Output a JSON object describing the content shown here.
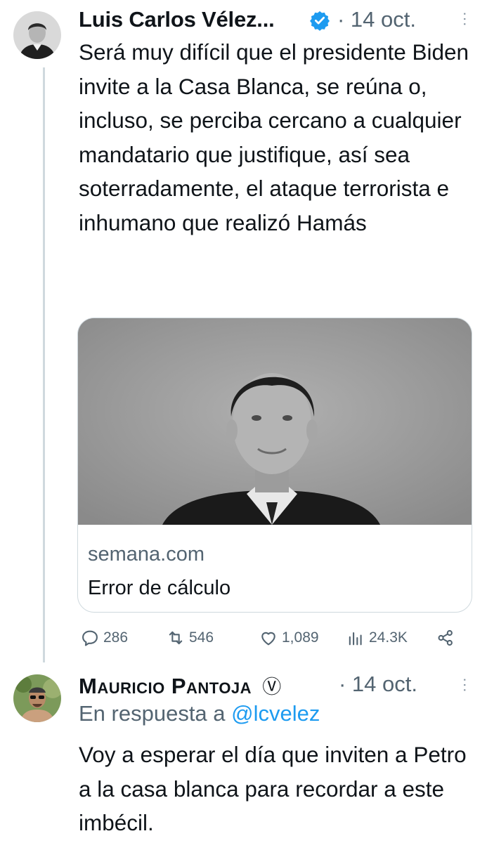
{
  "tweet": {
    "author_name": "Luis Carlos Vélez...",
    "verified_icon": "verified-badge-icon",
    "time": "· 14 oct.",
    "more": "···",
    "text": "Será muy difícil que el presidente Biden invite a la Casa Blanca, se reúna o, incluso, se perciba cercano a cualquier mandatario que justifique, así sea soterradamente, el ataque terrorista e inhumano que realizó Hamás",
    "card": {
      "domain": "semana.com",
      "title": "Error de cálculo"
    },
    "actions": {
      "replies": "286",
      "retweets": "546",
      "likes": "1,089",
      "views": "24.3K"
    }
  },
  "reply": {
    "author_name": "Mauricio Pantoja",
    "author_badge": "Ⓥ",
    "time": "· 14 oct.",
    "more": "···",
    "in_reply_prefix": "En respuesta a",
    "in_reply_handle": "@lcvelez",
    "text": "Voy a esperar el día que inviten a Petro a la casa blanca para recordar a este imbécil."
  },
  "colors": {
    "link_blue": "#1d9bf0",
    "secondary_text": "#536471",
    "border": "#cfd9de"
  }
}
